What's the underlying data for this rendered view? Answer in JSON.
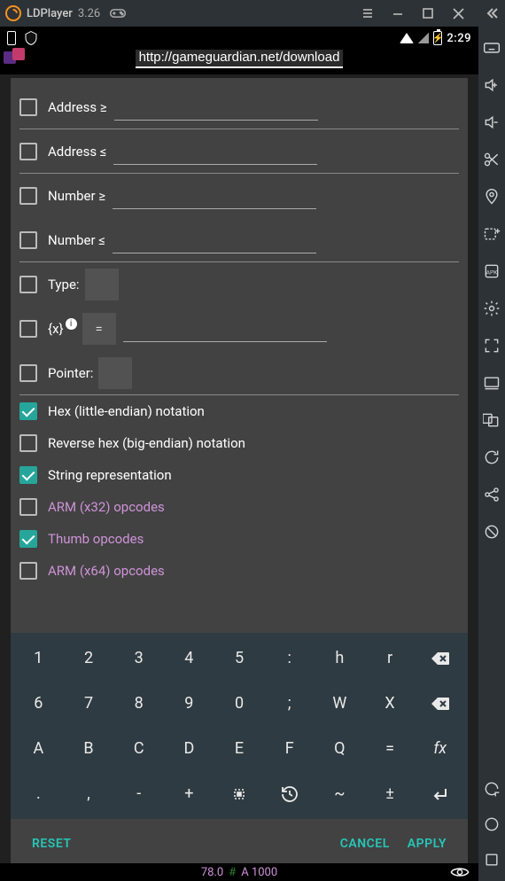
{
  "titlebar": {
    "app": "LDPlayer",
    "version": "3.26"
  },
  "statusbar": {
    "time": "2:29"
  },
  "url": "http://gameguardian.net/download",
  "filters": {
    "address_ge": {
      "label": "Address ≥",
      "value": ""
    },
    "address_le": {
      "label": "Address ≤",
      "value": ""
    },
    "number_ge": {
      "label": "Number ≥",
      "value": ""
    },
    "number_le": {
      "label": "Number ≤",
      "value": ""
    },
    "type": {
      "label": "Type:",
      "value": ""
    },
    "set": {
      "label": "{x}",
      "op": "=",
      "value": ""
    },
    "pointer": {
      "label": "Pointer:",
      "value": ""
    }
  },
  "options": [
    {
      "label": "Hex (little-endian) notation",
      "checked": true,
      "pink": false
    },
    {
      "label": "Reverse hex (big-endian) notation",
      "checked": false,
      "pink": false
    },
    {
      "label": "String representation",
      "checked": true,
      "pink": false
    },
    {
      "label": "ARM (x32) opcodes",
      "checked": false,
      "pink": true
    },
    {
      "label": "Thumb opcodes",
      "checked": true,
      "pink": true
    },
    {
      "label": "ARM (x64) opcodes",
      "checked": false,
      "pink": true
    }
  ],
  "keyboard": {
    "rows": [
      [
        "1",
        "2",
        "3",
        "4",
        "5",
        ":",
        "h",
        "r",
        "BKSP"
      ],
      [
        "6",
        "7",
        "8",
        "9",
        "0",
        ";",
        "W",
        "X",
        "BKSP"
      ],
      [
        "A",
        "B",
        "C",
        "D",
        "E",
        "F",
        "Q",
        "=",
        "fx"
      ],
      [
        ".",
        ",",
        "-",
        "+",
        "SEL",
        "HIST",
        "~",
        "±",
        "ENTER"
      ]
    ]
  },
  "actions": {
    "reset": "RESET",
    "cancel": "CANCEL",
    "apply": "APPLY"
  },
  "footer": {
    "v1": "78.0",
    "hash": "#",
    "v2": "A 1000"
  },
  "side_icons": [
    "keyboard",
    "volume-up",
    "volume-down",
    "scissors",
    "location",
    "add-window",
    "apk",
    "settings",
    "fullscreen",
    "display",
    "copy",
    "rotate",
    "share",
    "no-rotate"
  ],
  "side_bottom": [
    "back",
    "home",
    "recents"
  ]
}
